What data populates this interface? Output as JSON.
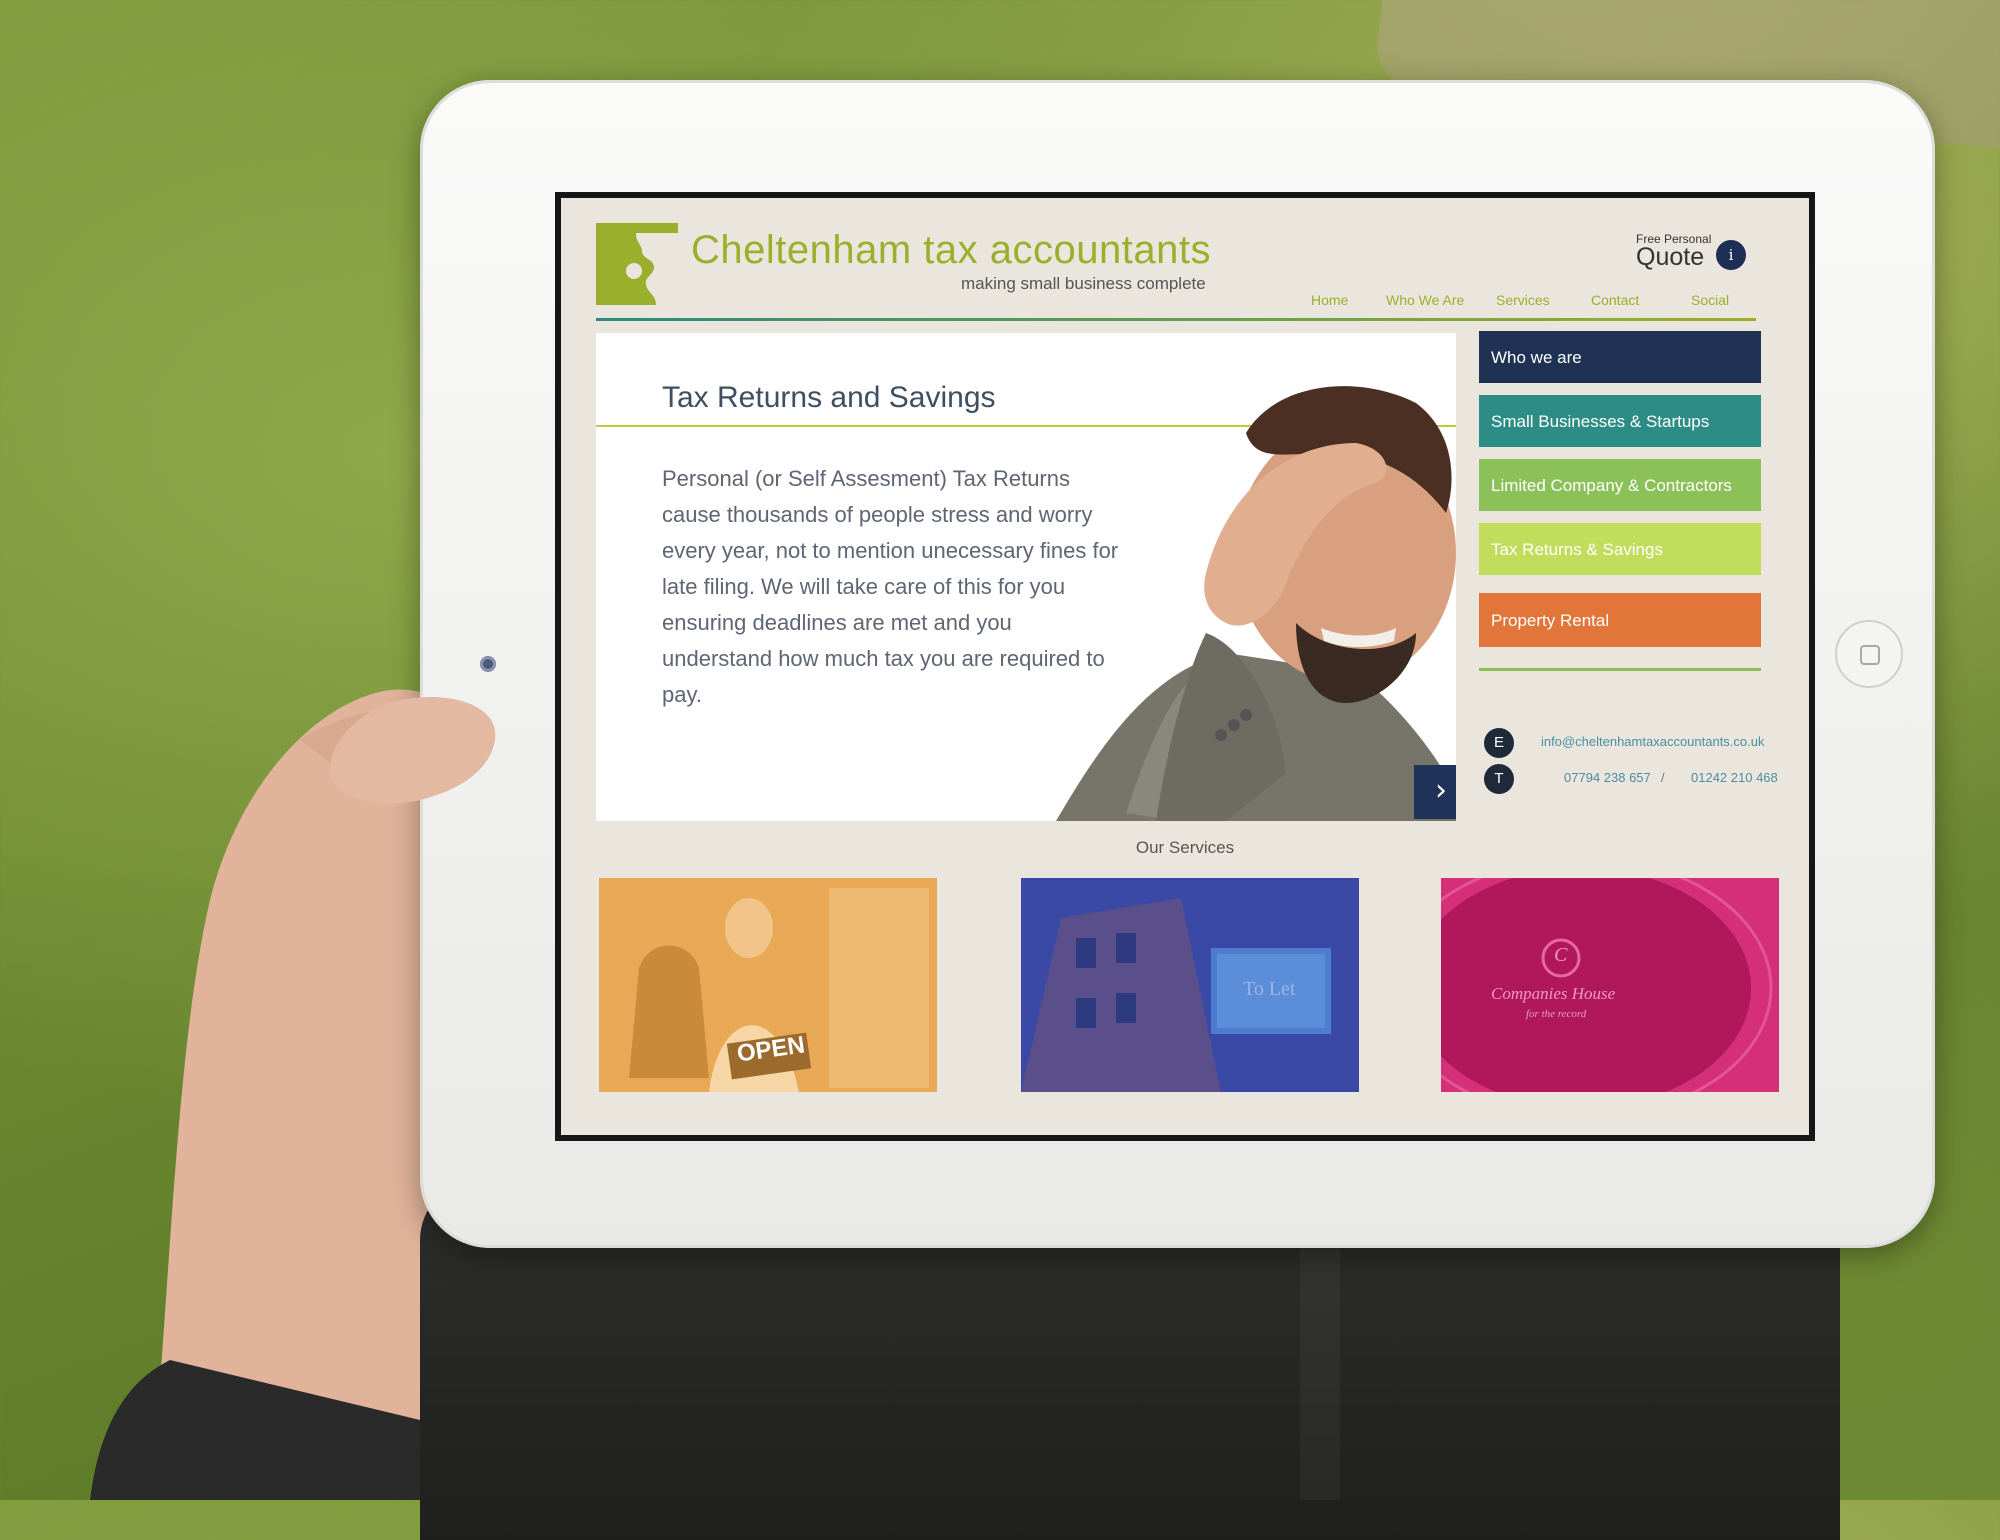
{
  "site": {
    "brand": "Cheltenham tax accountants",
    "tagline": "making small business complete",
    "quote_small": "Free Personal",
    "quote_big": "Quote",
    "info_icon": "i"
  },
  "nav": [
    {
      "label": "Home"
    },
    {
      "label": "Who We Are"
    },
    {
      "label": "Services"
    },
    {
      "label": "Contact"
    },
    {
      "label": "Social"
    }
  ],
  "hero": {
    "title": "Tax Returns and Savings",
    "body": "Personal (or Self Assesment) Tax Returns cause thousands of people stress and worry every year, not to mention unecessary fines for late filing. We will take care of this for you ensuring deadlines are met and you understand how much tax you are required to pay.",
    "next_icon": "›"
  },
  "side_menu": [
    {
      "label": "Who we are",
      "color": "#1f3253"
    },
    {
      "label": "Small Businesses & Startups",
      "color": "#2e8c86"
    },
    {
      "label": "Limited Company & Contractors",
      "color": "#8cc15a"
    },
    {
      "label": "Tax Returns & Savings",
      "color": "#c2dc5c"
    },
    {
      "label": "Property Rental",
      "color": "#e2753a"
    }
  ],
  "contact": {
    "email_icon": "E",
    "phone_icon": "T",
    "email": "info@cheltenhamtaxaccountants.co.uk",
    "phone_mobile": "07794 238 657",
    "separator": "/",
    "phone_landline": "01242 210 468"
  },
  "services": {
    "heading": "Our Services",
    "tiles": [
      {
        "sign": "OPEN",
        "color": "#e5a24c"
      },
      {
        "sign": "To Let",
        "color": "#3b4aa8"
      },
      {
        "logo_text": "Companies House",
        "logo_sub": "for the record",
        "logo_mark": "C",
        "color": "#d8307a"
      }
    ]
  },
  "colors": {
    "brand_green": "#9aaf2c",
    "navy": "#1e3357",
    "screen_bg": "#ebe6dd"
  }
}
